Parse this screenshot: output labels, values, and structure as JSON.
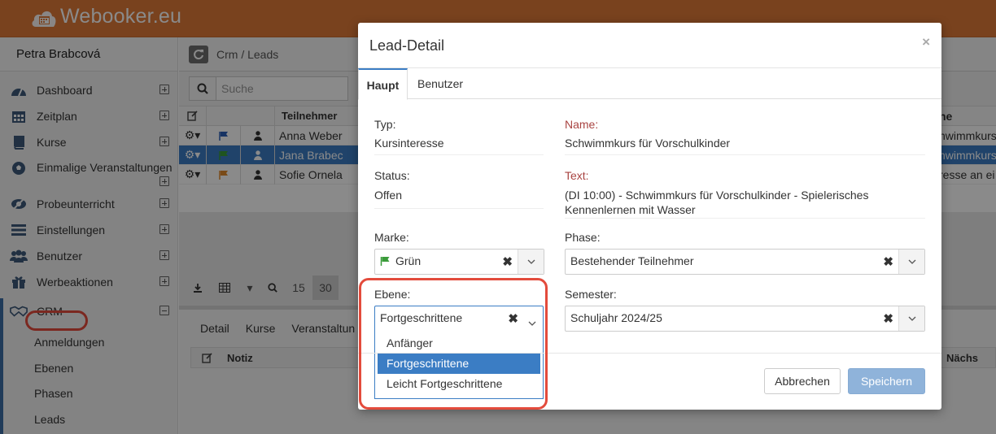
{
  "app": {
    "logo_text": "Webooker.eu",
    "logo_icon": "calendar-cloud-icon"
  },
  "sidebar": {
    "user_name": "Petra Brabcová",
    "items": [
      {
        "label": "Dashboard",
        "icon": "tachometer-icon",
        "expander": "plus"
      },
      {
        "label": "Zeitplan",
        "icon": "calendar-icon",
        "expander": "plus"
      },
      {
        "label": "Kurse",
        "icon": "book-icon",
        "expander": "plus"
      },
      {
        "label": "Einmalige Veranstaltungen",
        "icon": "football-icon",
        "expander": "plus"
      },
      {
        "label": "Probeunterricht",
        "icon": "eye-slash-icon",
        "expander": "plus"
      },
      {
        "label": "Einstellungen",
        "icon": "sliders-icon",
        "expander": "plus"
      },
      {
        "label": "Benutzer",
        "icon": "users-icon",
        "expander": "plus"
      },
      {
        "label": "Werbeaktionen",
        "icon": "gift-icon",
        "expander": "plus"
      },
      {
        "label": "CRM",
        "icon": "handshake-icon",
        "expander": "minus"
      }
    ],
    "crm_sub": [
      "Anmeldungen",
      "Ebenen",
      "Phasen",
      "Leads"
    ]
  },
  "main": {
    "breadcrumb": "Crm / Leads",
    "search_placeholder": "Suche",
    "grid": {
      "col_name": "Teilnehmer",
      "col_tail": "ne",
      "rows": [
        {
          "name": "Anna Weber",
          "flag_color": "#2c5fb8",
          "tail": "hwimmkurs f"
        },
        {
          "name": "Jana Brabec",
          "flag_color": "#3a9b3a",
          "tail": "hwimmkurs f"
        },
        {
          "name": "Sofie Ornela",
          "flag_color": "#e08a2c",
          "tail": "resse an ei"
        }
      ]
    },
    "pager": {
      "size_a": "15",
      "size_b": "30"
    },
    "lower_tabs": [
      "Detail",
      "Kurse",
      "Veranstaltun"
    ],
    "lower_head": {
      "notiz": "Notiz",
      "next": "Nächs"
    }
  },
  "modal": {
    "title": "Lead-Detail",
    "close": "×",
    "tabs": {
      "haupt": "Haupt",
      "benutzer": "Benutzer"
    },
    "typ": {
      "label": "Typ:",
      "value": "Kursinteresse"
    },
    "name": {
      "label": "Name:",
      "value": "Schwimmkurs für Vorschulkinder"
    },
    "status": {
      "label": "Status:",
      "value": "Offen"
    },
    "text": {
      "label": "Text:",
      "value_line1": "(DI 10:00) - Schwimmkurs für Vorschulkinder - Spielerisches",
      "value_line2": "Kennenlernen mit Wasser"
    },
    "marke": {
      "label": "Marke:",
      "value": "Grün",
      "flag_color": "#3a9b3a"
    },
    "phase": {
      "label": "Phase:",
      "value": "Bestehender Teilnehmer"
    },
    "ebene": {
      "label": "Ebene:",
      "value": "Fortgeschrittene",
      "options": [
        "Anfänger",
        "Fortgeschrittene",
        "Leicht Fortgeschrittene"
      ],
      "selected_index": 1
    },
    "semester": {
      "label": "Semester:",
      "value": "Schuljahr 2024/25"
    },
    "buttons": {
      "cancel": "Abbrechen",
      "save": "Speichern"
    },
    "clear_glyph": "✖"
  },
  "colors": {
    "topbar": "#e07a38",
    "accent": "#3b7dc4",
    "highlight_ring": "#e34b3c"
  }
}
